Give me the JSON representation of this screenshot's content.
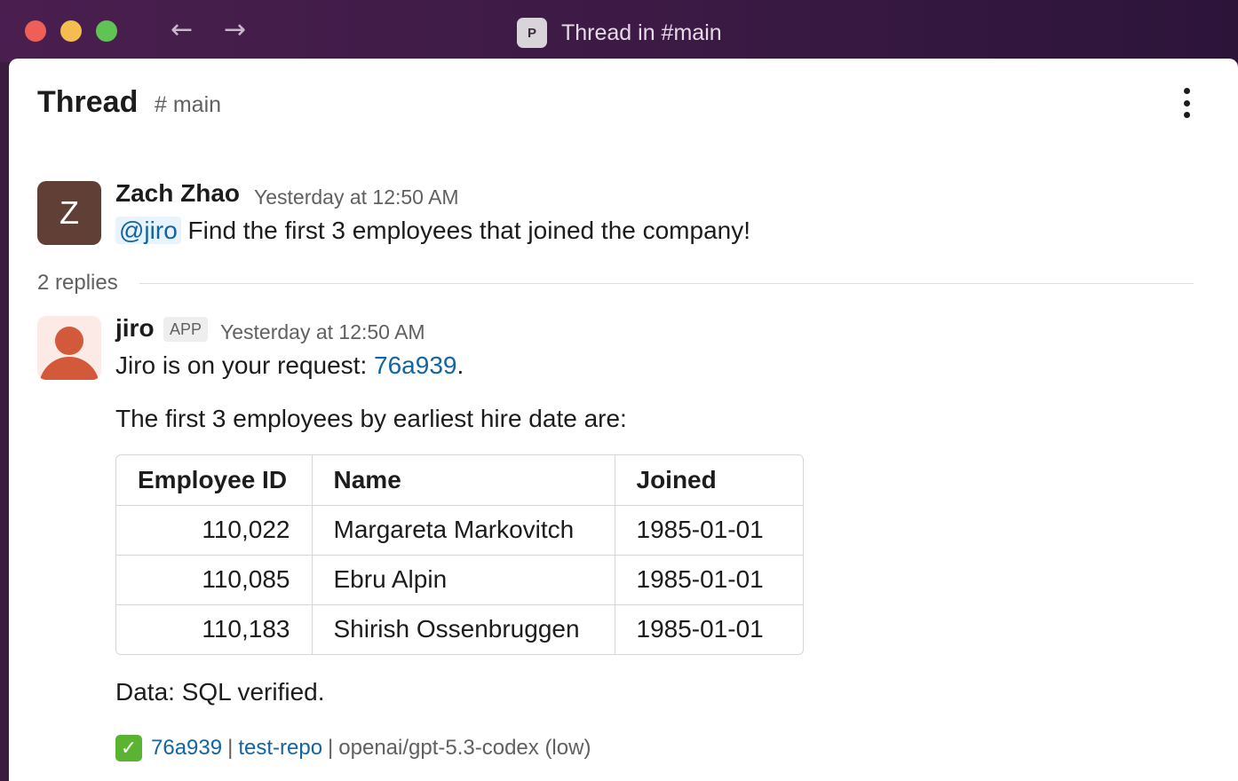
{
  "window": {
    "workspace_initial": "P",
    "title": "Thread in #main"
  },
  "header": {
    "title": "Thread",
    "channel": "# main"
  },
  "parent_message": {
    "avatar_initial": "Z",
    "author": "Zach Zhao",
    "timestamp": "Yesterday at 12:50 AM",
    "mention": "@jiro",
    "text": " Find the first 3 employees that joined the company!"
  },
  "replies": {
    "count_label": "2 replies"
  },
  "reply_message": {
    "author": "jiro",
    "badge": "APP",
    "timestamp": "Yesterday at 12:50 AM",
    "line1_prefix": "Jiro is on your request: ",
    "line1_link": "76a939",
    "line1_suffix": ".",
    "line2": "The first 3 employees by earliest hire date are:",
    "table": {
      "headers": [
        "Employee ID",
        "Name",
        "Joined"
      ],
      "rows": [
        [
          "110,022",
          "Margareta Markovitch",
          "1985-01-01"
        ],
        [
          "110,085",
          "Ebru Alpin",
          "1985-01-01"
        ],
        [
          "110,183",
          "Shirish Ossenbruggen",
          "1985-01-01"
        ]
      ]
    },
    "line3": "Data: SQL verified.",
    "footer": {
      "check_icon": "white-check-mark-icon",
      "commit_link": "76a939",
      "separator": "|",
      "repo_link": "test-repo",
      "model": "openai/gpt-5.3-codex (low)"
    }
  },
  "colors": {
    "link": "#1264a3",
    "mention_bg": "#e8f3fb",
    "titlebar": "#3b1a44",
    "avatar_z": "#5f3f36",
    "avatar_jiro": "#d3593b"
  }
}
